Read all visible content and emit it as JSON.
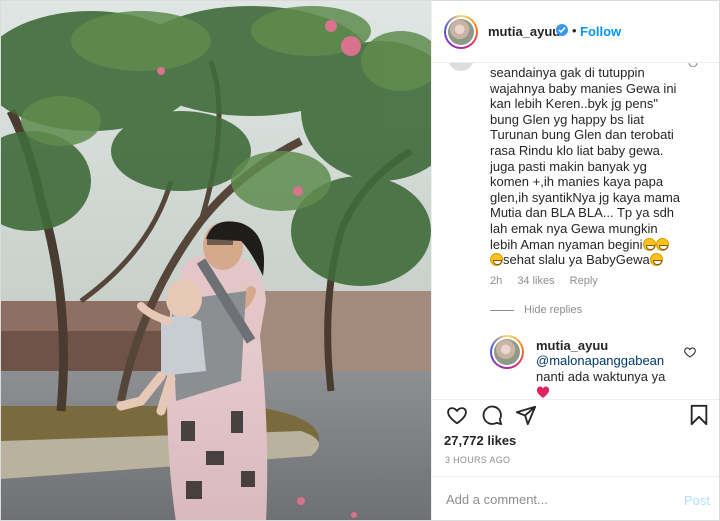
{
  "header": {
    "username": "mutia_ayuu",
    "separator": "•",
    "follow_label": "Follow"
  },
  "comment": {
    "text_lines": [
      "seandainya gak di tutuppin",
      "wajahnya baby manies Gewa ini",
      "kan lebih Keren..byk jg pens\"",
      "bung Glen yg happy bs liat",
      "Turunan bung Glen dan terobati",
      "rasa Rindu klo liat baby gewa.",
      "juga pasti makin banyak yg",
      "komen +,ih manies kaya papa",
      "glen,ih syantikNya jg kaya mama",
      "Mutia dan BLA BLA... Tp ya sdh",
      "lah emak nya Gewa mungkin",
      "lebih Aman nyaman begini",
      "sehat slalu ya BabyGewa"
    ],
    "time": "2h",
    "likes": "34 likes",
    "reply_label": "Reply",
    "hide_replies_label": "Hide replies"
  },
  "reply": {
    "username": "mutia_ayuu",
    "mention": "@malonapanggabean",
    "text": "nanti ada waktunya ya"
  },
  "post": {
    "likes": "27,772 likes",
    "timestamp": "3 HOURS AGO",
    "add_comment_placeholder": "Add a comment...",
    "post_label": "Post"
  },
  "colors": {
    "link_blue": "#0095f6",
    "post_disabled": "#b2dffc",
    "muted": "#8e8e8e",
    "text": "#262626",
    "verified": "#3897f0"
  },
  "icons": [
    "heart-icon",
    "comment-icon",
    "share-icon",
    "bookmark-icon",
    "verified-icon",
    "small-heart-icon",
    "more-options-icon"
  ]
}
